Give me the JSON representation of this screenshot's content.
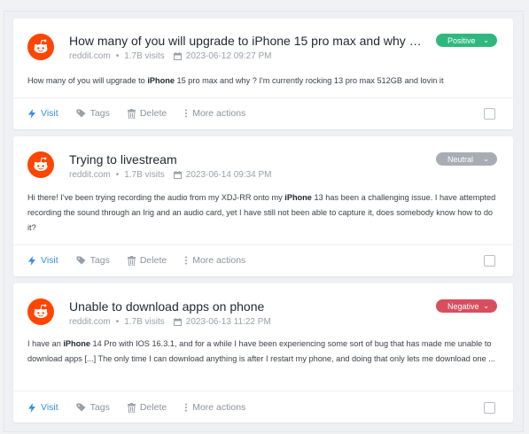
{
  "posts": [
    {
      "title": "How many of you will upgrade to iPhone 15 pro max and why ? I'm currently rocking 13 pro max 512GB and lovin it",
      "source": "reddit.com",
      "visits": "1.7B visits",
      "datetime": "2023-06-12 09:27 PM",
      "sentiment": "Positive",
      "sentiment_color": "#2fb87e",
      "body_before": "How many of you will upgrade to ",
      "body_bold": "iPhone",
      "body_after": " 15 pro max and why ? I'm currently rocking 13 pro max 512GB and lovin it"
    },
    {
      "title": "Trying to livestream",
      "source": "reddit.com",
      "visits": "1.7B visits",
      "datetime": "2023-06-14 09:34 PM",
      "sentiment": "Neutral",
      "sentiment_color": "#a8adb5",
      "body_before": "Hi there! I've been trying recording the audio from my XDJ-RR onto my ",
      "body_bold": "iPhone",
      "body_after": " 13 has been a challenging issue. I have attempted recording the sound through an Irig and an audio card, yet I have still not been able to capture it, does somebody know how to do it?"
    },
    {
      "title": "Unable to download apps on phone",
      "source": "reddit.com",
      "visits": "1.7B visits",
      "datetime": "2023-06-13 11:22 PM",
      "sentiment": "Negative",
      "sentiment_color": "#d94e5e",
      "body_before": "I have an ",
      "body_bold": "iPhone",
      "body_after": " 14 Pro with IOS 16.3.1, and for a while I have been experiencing some sort of bug that has made me unable to download apps [...] The only time I can download anything is after I restart my phone, and doing that only lets me download one ..."
    }
  ],
  "actions": {
    "visit": "Visit",
    "tags": "Tags",
    "delete": "Delete",
    "more": "More actions"
  },
  "icons": {
    "source_avatar": "reddit-icon",
    "date": "calendar-icon",
    "visit": "lightning-icon",
    "tags": "tag-icon",
    "delete": "trash-icon",
    "more": "dots-vertical-icon",
    "badge": "chevron-down-icon"
  }
}
